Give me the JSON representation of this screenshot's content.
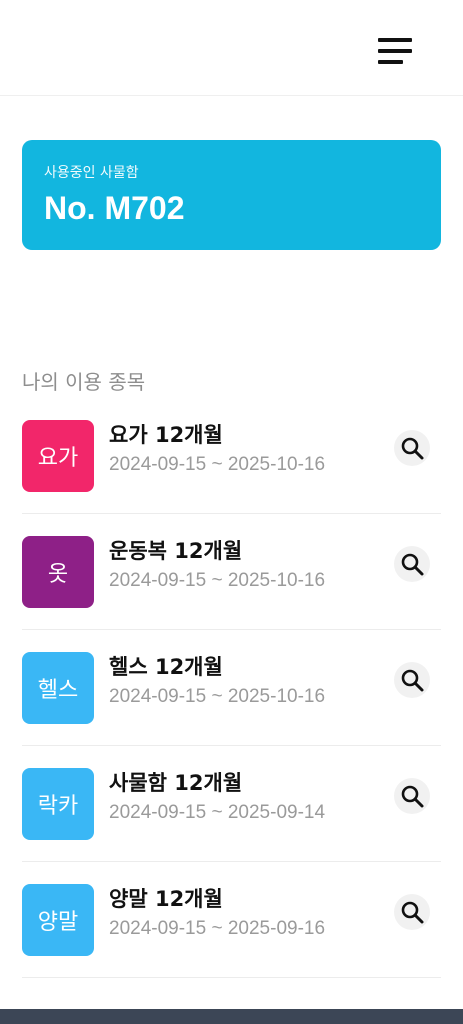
{
  "header": {
    "menu_icon": "hamburger-menu-icon"
  },
  "locker": {
    "caption": "사용중인 사물함",
    "number": "No. M702",
    "color": "#12b6df"
  },
  "section": {
    "title": "나의 이용 종목"
  },
  "items": [
    {
      "badge": "요가",
      "badge_color": "#f2266a",
      "title": "요가 12개월",
      "period": "2024-09-15 ~ 2025-10-16"
    },
    {
      "badge": "옷",
      "badge_color": "#8e2087",
      "title": "운동복 12개월",
      "period": "2024-09-15 ~ 2025-10-16"
    },
    {
      "badge": "헬스",
      "badge_color": "#3ab7f5",
      "title": "헬스 12개월",
      "period": "2024-09-15 ~ 2025-10-16"
    },
    {
      "badge": "락카",
      "badge_color": "#3ab7f5",
      "title": "사물함 12개월",
      "period": "2024-09-15 ~ 2025-09-14"
    },
    {
      "badge": "양말",
      "badge_color": "#3ab7f5",
      "title": "양말 12개월",
      "period": "2024-09-15 ~ 2025-09-16"
    }
  ],
  "search_icon": "search-icon"
}
